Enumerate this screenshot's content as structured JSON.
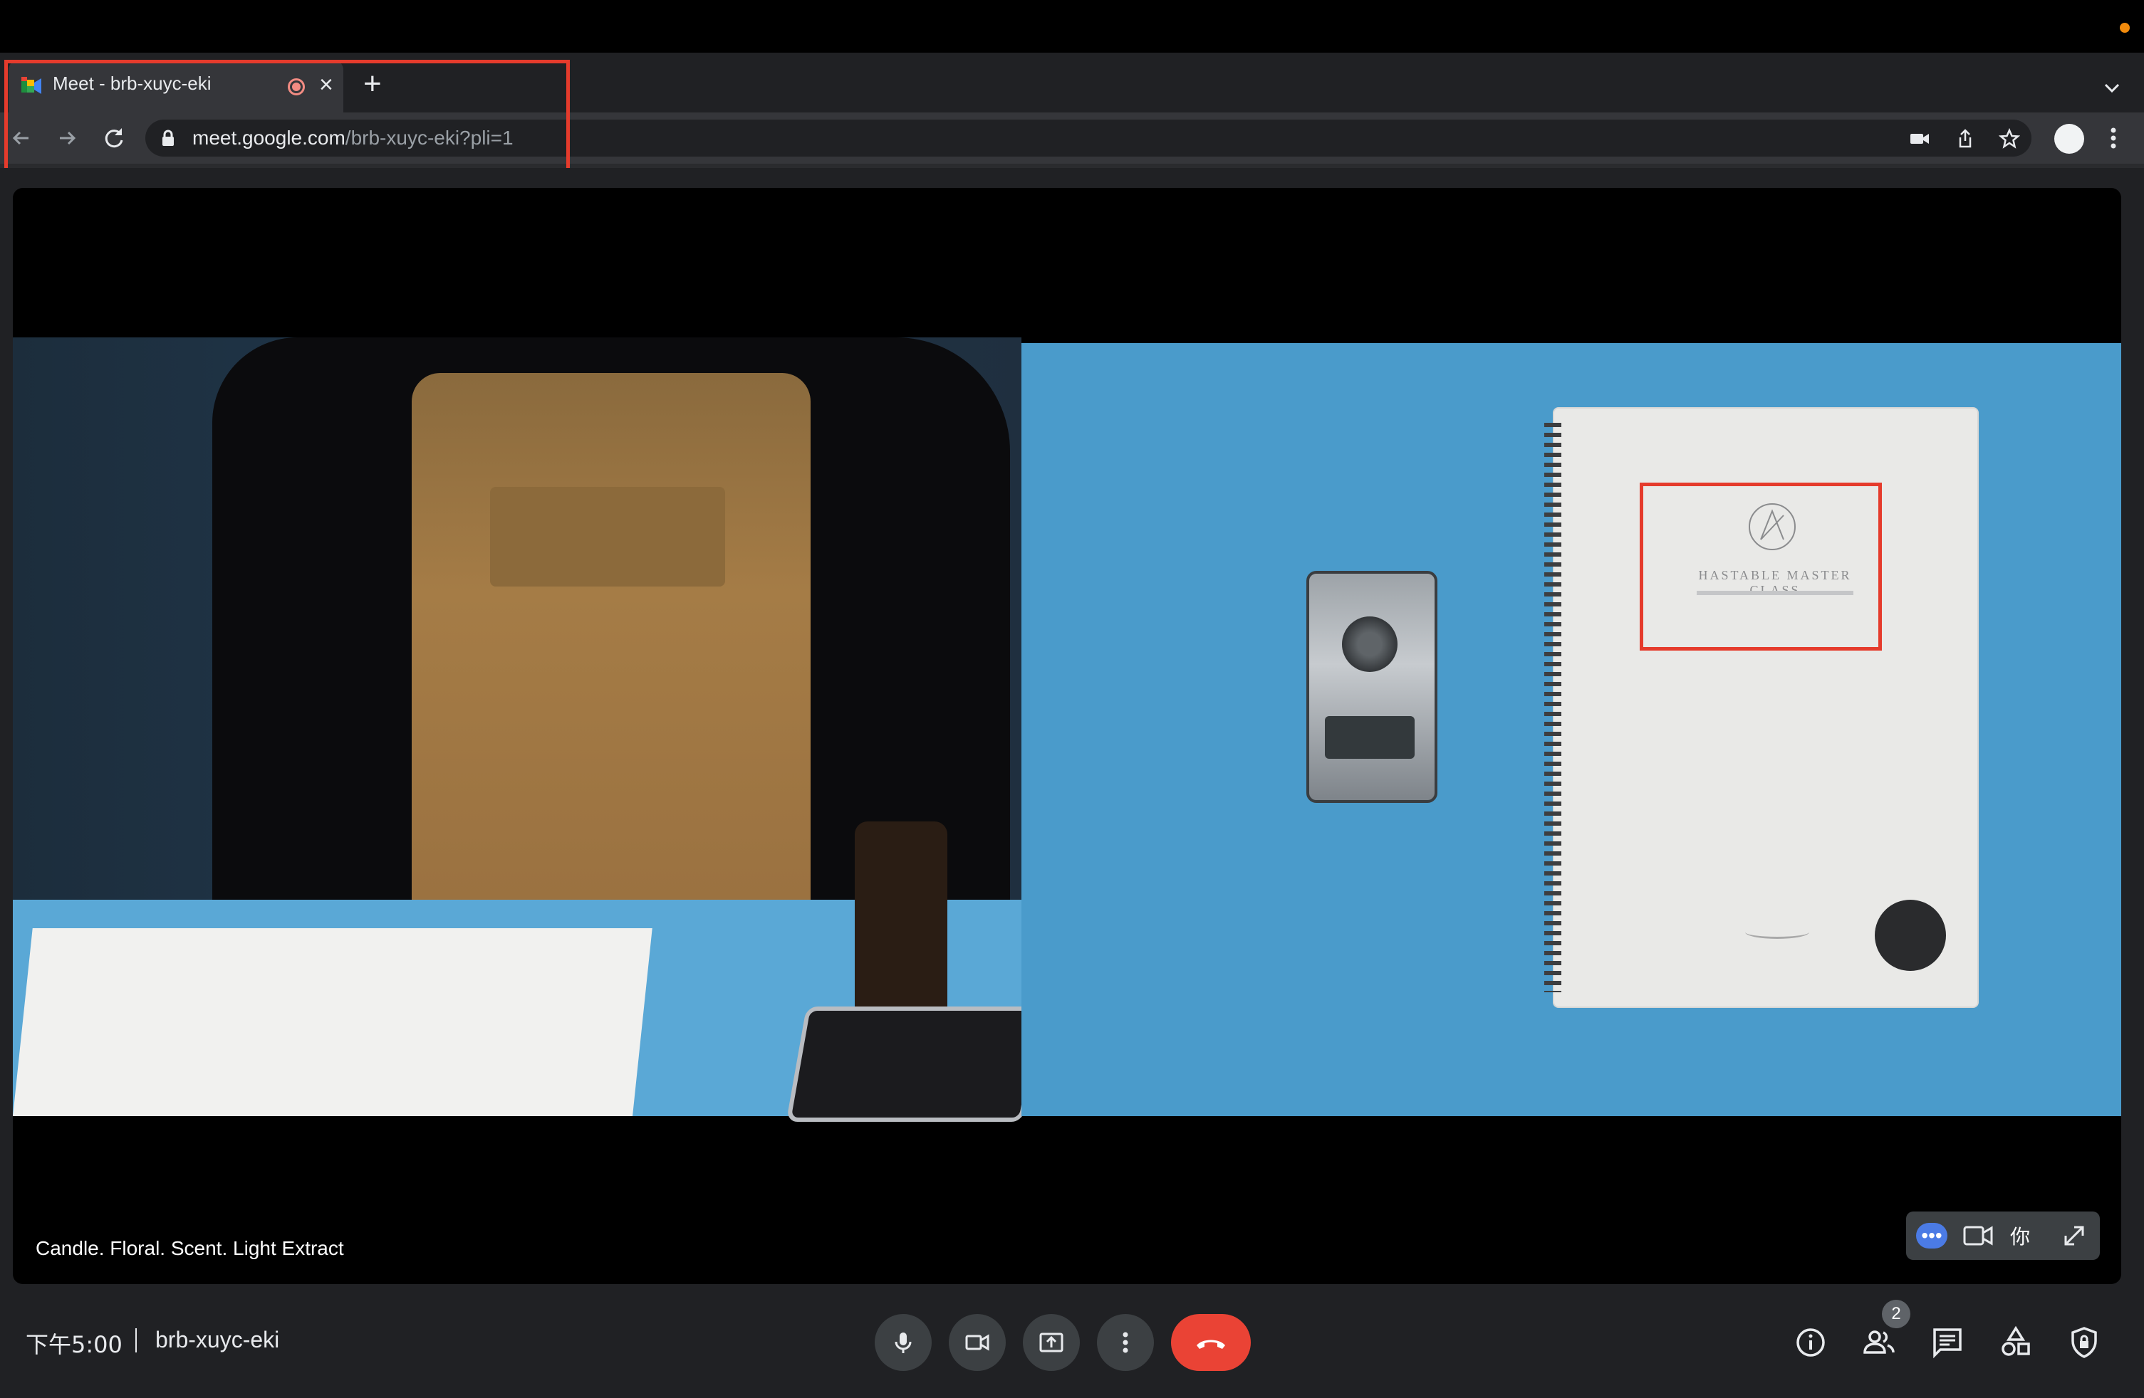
{
  "browser": {
    "tab_title": "Meet - brb-xuyc-eki",
    "url_host": "meet.google.com",
    "url_path": "/brb-xuyc-eki?pli=1",
    "icons": [
      "back-icon",
      "forward-icon",
      "reload-icon",
      "lock-icon",
      "camera-icon",
      "share-icon",
      "star-icon",
      "profile-avatar",
      "more-vert-icon",
      "recording-icon",
      "close-icon",
      "new-tab-icon",
      "tab-search-icon"
    ]
  },
  "stage": {
    "caption": "Candle. Floral. Scent. Light Extract",
    "notebook_title": "HASTABLE MASTER CLASS",
    "self_label": "你",
    "self_more": "•••"
  },
  "controls": {
    "time": "下午5:00",
    "meeting_code": "brb-xuyc-eki",
    "participants_count": "2",
    "hangup_color": "#ea4335"
  },
  "colors": {
    "highlight": "#e53b2c",
    "accent": "#4b7be5"
  }
}
